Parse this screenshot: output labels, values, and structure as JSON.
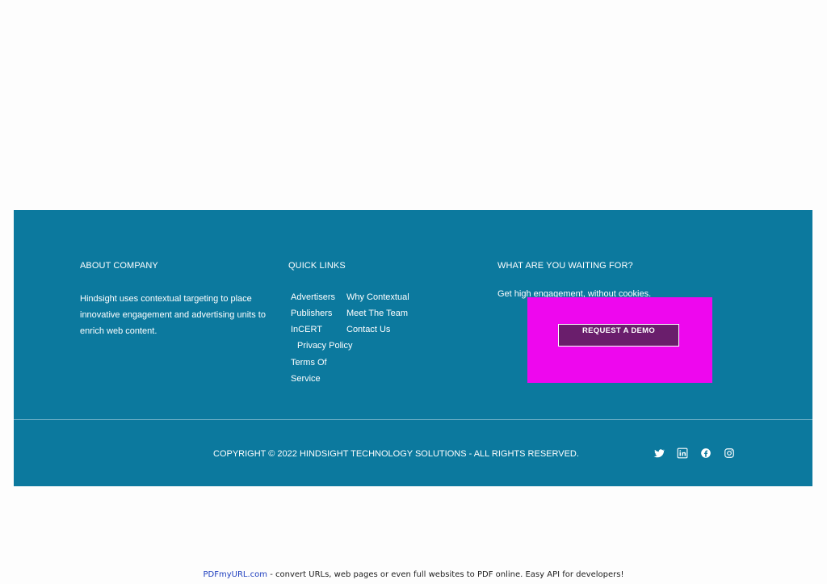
{
  "footer": {
    "about": {
      "title": "ABOUT COMPANY",
      "text": "Hindsight uses contextual targeting to place innovative engagement and advertising units to enrich web content."
    },
    "quick_links": {
      "title": "QUICK LINKS",
      "items": [
        "Advertisers",
        "Why Contextual",
        "Publishers",
        "Meet The Team",
        "InCERT",
        "Contact Us",
        "Privacy Policy",
        "Terms Of",
        "Service"
      ]
    },
    "cta": {
      "title": "WHAT ARE YOU WAITING FOR?",
      "text": "Get high engagement, without cookies.",
      "button_label": "REQUEST A DEMO"
    },
    "copyright": "COPYRIGHT © 2022 HINDSIGHT TECHNOLOGY SOLUTIONS - ALL RIGHTS RESERVED.",
    "social_icons": [
      "twitter-icon",
      "linkedin-icon",
      "facebook-icon",
      "instagram-icon"
    ]
  },
  "banner": {
    "link_text": "PDFmyURL.com",
    "text": " - convert URLs, web pages or even full websites to PDF online. Easy API for developers!"
  },
  "colors": {
    "footer_bg": "#0c799e",
    "highlight_box": "#ee07ee",
    "button_bg": "#6a1e6c"
  }
}
